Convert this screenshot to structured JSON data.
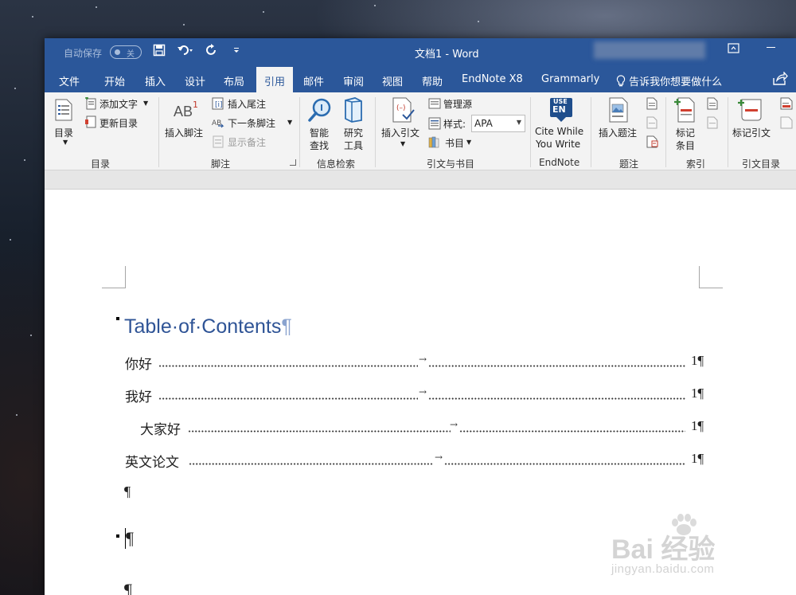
{
  "titlebar": {
    "autosave_label": "自动保存",
    "autosave_state": "关",
    "document_title": "文档1  -  Word",
    "colors": {
      "title_bg": "#2b579a",
      "active_tab_text": "#2b579a",
      "heading_blue": "#2f5496"
    }
  },
  "ribbon_tabs": {
    "file": "文件",
    "home": "开始",
    "insert": "插入",
    "design": "设计",
    "layout": "布局",
    "references": "引用",
    "mailings": "邮件",
    "review": "审阅",
    "view": "视图",
    "help": "帮助",
    "endnote": "EndNote X8",
    "grammarly": "Grammarly",
    "tell_me": "告诉我你想要做什么"
  },
  "ribbon": {
    "toc": {
      "button": "目录",
      "add_text": "添加文字",
      "update_table": "更新目录",
      "group": "目录"
    },
    "footnotes": {
      "insert_footnote": "插入脚注",
      "insert_endnote": "插入尾注",
      "next_footnote": "下一条脚注",
      "show_notes": "显示备注",
      "group": "脚注",
      "ab_glyph": "AB",
      "sup": "1"
    },
    "research": {
      "smart_lookup_1": "智能",
      "smart_lookup_2": "查找",
      "researcher_1": "研究",
      "researcher_2": "工具",
      "group": "信息检索"
    },
    "citations": {
      "insert_citation": "插入引文",
      "manage_sources": "管理源",
      "style_label": "样式:",
      "style_value": "APA",
      "bibliography": "书目",
      "group": "引文与书目"
    },
    "endnote": {
      "cite_1": "Cite While",
      "cite_2": "You Write",
      "group": "EndNote",
      "logo_top": "USE",
      "logo_bottom": "EN"
    },
    "captions": {
      "insert_caption": "插入题注",
      "group": "题注"
    },
    "index": {
      "mark_entry_1": "标记",
      "mark_entry_2": "条目",
      "group": "索引"
    },
    "citation_table": {
      "mark_citation": "标记引文",
      "group": "引文目录"
    }
  },
  "document": {
    "toc_heading": "Table·of·Contents",
    "pilcrow": "¶",
    "tab_arrow": "→",
    "entries": [
      {
        "label": "你好",
        "page": "1¶"
      },
      {
        "label": "我好",
        "page": "1¶"
      },
      {
        "label": "大家好",
        "page": "1¶"
      },
      {
        "label": "英文论文",
        "page": "1¶"
      }
    ]
  },
  "watermark": {
    "brand": "Bai  经验",
    "url": "jingyan.baidu.com"
  }
}
